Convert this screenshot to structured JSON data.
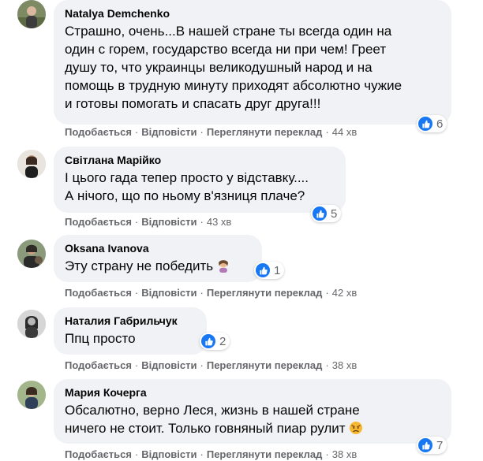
{
  "comments": [
    {
      "author": "Natalya Demchenko",
      "text_lines": [
        "Страшно, очень...В нашей стране ты всегда один на",
        "один с горем, государство всегда ни при чем! Греет",
        "душу то, что украинцы великодушный народ и на",
        "помощь в трудную минуту приходят абсолютно чужие",
        "и готовы помогать и спасать друг друга!!!"
      ],
      "reaction_count": "6",
      "actions": {
        "like": "Подобається",
        "reply": "Відповісти",
        "translate": "Переглянути переклад"
      },
      "time": "44 хв"
    },
    {
      "author": "Світлана Марійко",
      "text_lines": [
        "І цього гада тепер просто у відставку....",
        "А нічого, що по ньому в'язниця плаче?"
      ],
      "reaction_count": "5",
      "actions": {
        "like": "Подобається",
        "reply": "Відповісти"
      },
      "time": "43 хв"
    },
    {
      "author": "Oksana Ivanova",
      "text_lines": [
        "Эту страну не победить"
      ],
      "emoji": "woman-facepalming-emoji",
      "reaction_count": "1",
      "actions": {
        "like": "Подобається",
        "reply": "Відповісти",
        "translate": "Переглянути переклад"
      },
      "time": "42 хв"
    },
    {
      "author": "Наталия Габрильчук",
      "text_lines": [
        "Ппц просто"
      ],
      "reaction_count": "2",
      "actions": {
        "like": "Подобається",
        "reply": "Відповісти",
        "translate": "Переглянути переклад"
      },
      "time": "38 хв"
    },
    {
      "author": "Мария Кочерга",
      "text_lines": [
        "Обсалютно, верно Леся, жизнь в нашей стране",
        "ничего не стоит. Только говняный пиар рулит"
      ],
      "emoji": "angry-face-emoji",
      "reaction_count": "7",
      "actions": {
        "like": "Подобається",
        "reply": "Відповісти",
        "translate": "Переглянути переклад"
      },
      "time": "38 хв"
    }
  ],
  "colors": {
    "bubble": "#f0f2f5",
    "meta": "#65676b",
    "like_blue": "#1877f2"
  },
  "separator": "·"
}
